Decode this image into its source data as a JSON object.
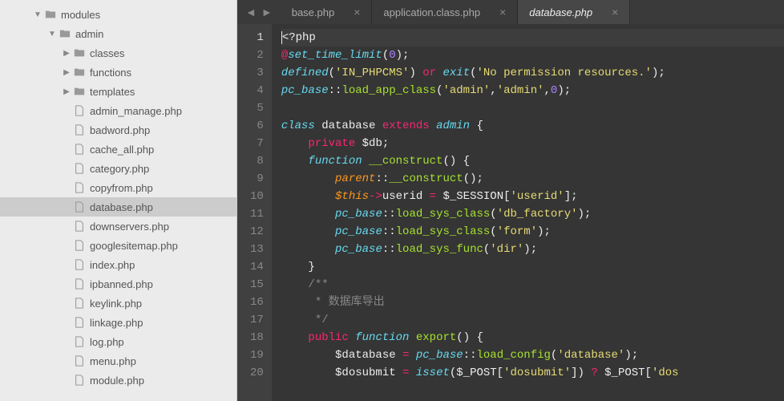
{
  "sidebar": {
    "items": [
      {
        "indent": 2,
        "type": "folder",
        "open": true,
        "label": "modules"
      },
      {
        "indent": 3,
        "type": "folder",
        "open": true,
        "label": "admin"
      },
      {
        "indent": 4,
        "type": "folder",
        "open": false,
        "label": "classes"
      },
      {
        "indent": 4,
        "type": "folder",
        "open": false,
        "label": "functions"
      },
      {
        "indent": 4,
        "type": "folder",
        "open": false,
        "label": "templates"
      },
      {
        "indent": 4,
        "type": "file",
        "label": "admin_manage.php"
      },
      {
        "indent": 4,
        "type": "file",
        "label": "badword.php"
      },
      {
        "indent": 4,
        "type": "file",
        "label": "cache_all.php"
      },
      {
        "indent": 4,
        "type": "file",
        "label": "category.php"
      },
      {
        "indent": 4,
        "type": "file",
        "label": "copyfrom.php"
      },
      {
        "indent": 4,
        "type": "file",
        "label": "database.php",
        "selected": true
      },
      {
        "indent": 4,
        "type": "file",
        "label": "downservers.php"
      },
      {
        "indent": 4,
        "type": "file",
        "label": "googlesitemap.php"
      },
      {
        "indent": 4,
        "type": "file",
        "label": "index.php"
      },
      {
        "indent": 4,
        "type": "file",
        "label": "ipbanned.php"
      },
      {
        "indent": 4,
        "type": "file",
        "label": "keylink.php"
      },
      {
        "indent": 4,
        "type": "file",
        "label": "linkage.php"
      },
      {
        "indent": 4,
        "type": "file",
        "label": "log.php"
      },
      {
        "indent": 4,
        "type": "file",
        "label": "menu.php"
      },
      {
        "indent": 4,
        "type": "file",
        "label": "module.php"
      }
    ]
  },
  "tabs": [
    {
      "label": "base.php",
      "active": false
    },
    {
      "label": "application.class.php",
      "active": false
    },
    {
      "label": "database.php",
      "active": true
    }
  ],
  "code": {
    "current_line": 1,
    "lines": [
      [
        {
          "t": "<",
          "c": "def",
          "cursor": true
        },
        {
          "t": "?php",
          "c": "def"
        }
      ],
      [
        {
          "t": "@",
          "c": "pink"
        },
        {
          "t": "set_time_limit",
          "c": "blue"
        },
        {
          "t": "(",
          "c": "def"
        },
        {
          "t": "0",
          "c": "purple"
        },
        {
          "t": ");",
          "c": "def"
        }
      ],
      [
        {
          "t": "defined",
          "c": "blue"
        },
        {
          "t": "(",
          "c": "def"
        },
        {
          "t": "'IN_PHPCMS'",
          "c": "yellow"
        },
        {
          "t": ") ",
          "c": "def"
        },
        {
          "t": "or",
          "c": "pink"
        },
        {
          "t": " ",
          "c": "def"
        },
        {
          "t": "exit",
          "c": "blue"
        },
        {
          "t": "(",
          "c": "def"
        },
        {
          "t": "'No permission resources.'",
          "c": "yellow"
        },
        {
          "t": ");",
          "c": "def"
        }
      ],
      [
        {
          "t": "pc_base",
          "c": "blue"
        },
        {
          "t": "::",
          "c": "def"
        },
        {
          "t": "load_app_class",
          "c": "green"
        },
        {
          "t": "(",
          "c": "def"
        },
        {
          "t": "'admin'",
          "c": "yellow"
        },
        {
          "t": ",",
          "c": "def"
        },
        {
          "t": "'admin'",
          "c": "yellow"
        },
        {
          "t": ",",
          "c": "def"
        },
        {
          "t": "0",
          "c": "purple"
        },
        {
          "t": ");",
          "c": "def"
        }
      ],
      [],
      [
        {
          "t": "class",
          "c": "blue"
        },
        {
          "t": " database ",
          "c": "def"
        },
        {
          "t": "extends",
          "c": "pink"
        },
        {
          "t": " ",
          "c": "def"
        },
        {
          "t": "admin",
          "c": "blue"
        },
        {
          "t": " {",
          "c": "def"
        }
      ],
      [
        {
          "t": "    ",
          "c": "def"
        },
        {
          "t": "private",
          "c": "pink"
        },
        {
          "t": " $db;",
          "c": "def"
        }
      ],
      [
        {
          "t": "    ",
          "c": "def"
        },
        {
          "t": "function",
          "c": "blue"
        },
        {
          "t": " ",
          "c": "def"
        },
        {
          "t": "__construct",
          "c": "green"
        },
        {
          "t": "() {",
          "c": "def"
        }
      ],
      [
        {
          "t": "        ",
          "c": "def"
        },
        {
          "t": "parent",
          "c": "orange"
        },
        {
          "t": "::",
          "c": "def"
        },
        {
          "t": "__construct",
          "c": "green"
        },
        {
          "t": "();",
          "c": "def"
        }
      ],
      [
        {
          "t": "        ",
          "c": "def"
        },
        {
          "t": "$this",
          "c": "orange"
        },
        {
          "t": "->",
          "c": "pink"
        },
        {
          "t": "userid ",
          "c": "def"
        },
        {
          "t": "=",
          "c": "pink"
        },
        {
          "t": " $_SESSION[",
          "c": "def"
        },
        {
          "t": "'userid'",
          "c": "yellow"
        },
        {
          "t": "];",
          "c": "def"
        }
      ],
      [
        {
          "t": "        ",
          "c": "def"
        },
        {
          "t": "pc_base",
          "c": "blue"
        },
        {
          "t": "::",
          "c": "def"
        },
        {
          "t": "load_sys_class",
          "c": "green"
        },
        {
          "t": "(",
          "c": "def"
        },
        {
          "t": "'db_factory'",
          "c": "yellow"
        },
        {
          "t": ");",
          "c": "def"
        }
      ],
      [
        {
          "t": "        ",
          "c": "def"
        },
        {
          "t": "pc_base",
          "c": "blue"
        },
        {
          "t": "::",
          "c": "def"
        },
        {
          "t": "load_sys_class",
          "c": "green"
        },
        {
          "t": "(",
          "c": "def"
        },
        {
          "t": "'form'",
          "c": "yellow"
        },
        {
          "t": ");",
          "c": "def"
        }
      ],
      [
        {
          "t": "        ",
          "c": "def"
        },
        {
          "t": "pc_base",
          "c": "blue"
        },
        {
          "t": "::",
          "c": "def"
        },
        {
          "t": "load_sys_func",
          "c": "green"
        },
        {
          "t": "(",
          "c": "def"
        },
        {
          "t": "'dir'",
          "c": "yellow"
        },
        {
          "t": ");",
          "c": "def"
        }
      ],
      [
        {
          "t": "    }",
          "c": "def"
        }
      ],
      [
        {
          "t": "    /**",
          "c": "gray"
        }
      ],
      [
        {
          "t": "     * 数据库导出",
          "c": "gray"
        }
      ],
      [
        {
          "t": "     */",
          "c": "gray"
        }
      ],
      [
        {
          "t": "    ",
          "c": "def"
        },
        {
          "t": "public",
          "c": "pink"
        },
        {
          "t": " ",
          "c": "def"
        },
        {
          "t": "function",
          "c": "blue"
        },
        {
          "t": " ",
          "c": "def"
        },
        {
          "t": "export",
          "c": "green"
        },
        {
          "t": "() {",
          "c": "def"
        }
      ],
      [
        {
          "t": "        $database ",
          "c": "def"
        },
        {
          "t": "=",
          "c": "pink"
        },
        {
          "t": " ",
          "c": "def"
        },
        {
          "t": "pc_base",
          "c": "blue"
        },
        {
          "t": "::",
          "c": "def"
        },
        {
          "t": "load_config",
          "c": "green"
        },
        {
          "t": "(",
          "c": "def"
        },
        {
          "t": "'database'",
          "c": "yellow"
        },
        {
          "t": ");",
          "c": "def"
        }
      ],
      [
        {
          "t": "        $dosubmit ",
          "c": "def"
        },
        {
          "t": "=",
          "c": "pink"
        },
        {
          "t": " ",
          "c": "def"
        },
        {
          "t": "isset",
          "c": "blue"
        },
        {
          "t": "($_POST[",
          "c": "def"
        },
        {
          "t": "'dosubmit'",
          "c": "yellow"
        },
        {
          "t": "]) ",
          "c": "def"
        },
        {
          "t": "?",
          "c": "pink"
        },
        {
          "t": " $_POST[",
          "c": "def"
        },
        {
          "t": "'dos",
          "c": "yellow"
        }
      ]
    ]
  }
}
